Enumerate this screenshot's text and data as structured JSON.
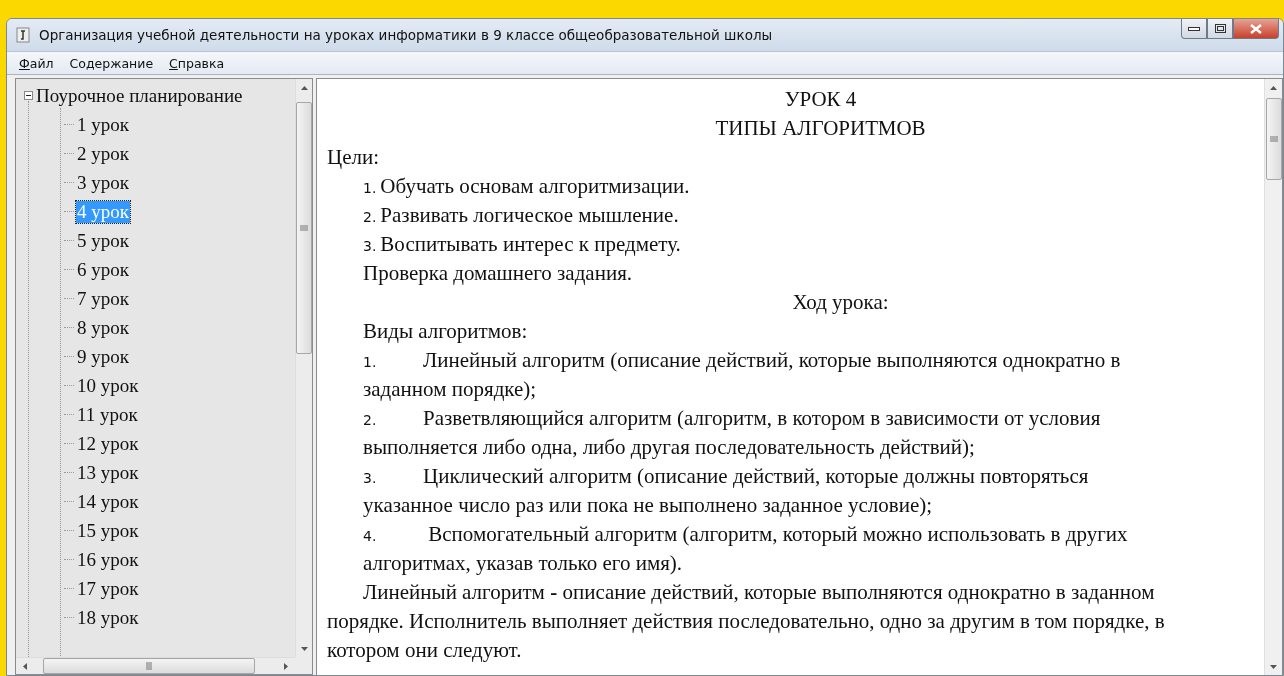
{
  "window": {
    "title": "Организация учебной деятельности на уроках  информатики в 9 классе общеобразовательной школы"
  },
  "menu": [
    {
      "label": "Файл",
      "mnemonic": true
    },
    {
      "label": "Содержание",
      "mnemonic": false
    },
    {
      "label": "Справка",
      "mnemonic": true
    }
  ],
  "tree": {
    "label": "Поурочное планирование",
    "expanded": true,
    "children": [
      {
        "label": "1 урок",
        "selected": false
      },
      {
        "label": "2 урок",
        "selected": false
      },
      {
        "label": "3 урок",
        "selected": false
      },
      {
        "label": "4 урок",
        "selected": true
      },
      {
        "label": "5 урок",
        "selected": false
      },
      {
        "label": "6 урок",
        "selected": false
      },
      {
        "label": "7 урок",
        "selected": false
      },
      {
        "label": "8 урок",
        "selected": false
      },
      {
        "label": "9 урок",
        "selected": false
      },
      {
        "label": "10 урок",
        "selected": false
      },
      {
        "label": "11 урок",
        "selected": false
      },
      {
        "label": "12 урок",
        "selected": false
      },
      {
        "label": "13 урок",
        "selected": false
      },
      {
        "label": "14 урок",
        "selected": false
      },
      {
        "label": "15 урок",
        "selected": false
      },
      {
        "label": "16 урок",
        "selected": false
      },
      {
        "label": "17 урок",
        "selected": false
      },
      {
        "label": "18 урок",
        "selected": false
      }
    ]
  },
  "document": {
    "heading": [
      "УРОК 4",
      "ТИПЫ АЛГОРИТМОВ"
    ],
    "blocks": [
      {
        "kind": "label",
        "text": "Цели:"
      },
      {
        "kind": "goal",
        "number": "1.",
        "text": "Обучать основам алгоритмизации."
      },
      {
        "kind": "goal",
        "number": "2.",
        "text": "Развивать логическое мышление."
      },
      {
        "kind": "goal",
        "number": "3.",
        "text": "Воспитывать интерес к предмету."
      },
      {
        "kind": "para",
        "text": "Проверка домашнего задания."
      },
      {
        "kind": "center",
        "text": "Ход урока:"
      },
      {
        "kind": "para",
        "text": "Виды алгоритмов:"
      },
      {
        "kind": "item",
        "number": "1.",
        "text": "Линейный алгоритм (описание действий, которые выполняются однократно в заданном порядке);"
      },
      {
        "kind": "item",
        "number": "2.",
        "text": "Разветвляющийся алгоритм (алгоритм, в котором в зависимости от условия выполняется либо одна, либо другая последовательность действий);"
      },
      {
        "kind": "item",
        "number": "3.",
        "text": "Циклический алгоритм (описание действий, которые должны повторяться указанное число раз или пока не выполнено заданное условие);"
      },
      {
        "kind": "item",
        "number": "4.",
        "text": " Вспомогательный алгоритм (алгоритм, который можно использовать в других алгоритмах, указав только его имя)."
      },
      {
        "kind": "body",
        "text": "Линейный алгоритм **-** описание действий, которые выполняются однократно в заданном порядке. Исполнитель выполняет действия последовательно, одно за другим в том порядке, в котором они следуют."
      }
    ]
  }
}
